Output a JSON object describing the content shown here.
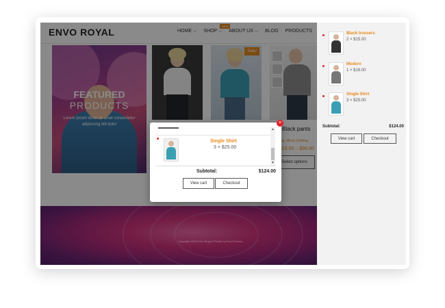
{
  "site": {
    "logo": "ENVO ROYAL",
    "nav": {
      "home": "HOME",
      "shop": "SHOP",
      "shop_badge": "NEW",
      "about": "ABOUT US",
      "blog": "BLOG",
      "products": "PRODUCTS"
    }
  },
  "hero": {
    "title": "FEATURED",
    "subtitle": "PRODUCTS",
    "text": "Lorem ipsum dolor sit amet consectetur adipiscing elit dolor"
  },
  "products": {
    "sale_badge": "Sale!",
    "third": {
      "title": "Black pants",
      "categories": "Clothing, Mens Clothing",
      "price": "$19.00 – $99.00",
      "button": "Select options"
    }
  },
  "side_cart": {
    "items": [
      {
        "name": "Black trousers",
        "qty": "2 × $15.00",
        "color": "#333333"
      },
      {
        "name": "Modern",
        "qty": "1 × $19.00",
        "color": "#777777"
      },
      {
        "name": "Single Shirt",
        "qty": "3 × $25.00",
        "color": "#3b9fb4"
      }
    ],
    "subtotal_label": "Subtotal:",
    "subtotal_value": "$124.00",
    "view_cart": "View cart",
    "checkout": "Checkout"
  },
  "popup": {
    "item": {
      "name": "Single Shirt",
      "qty": "3 × $25.00"
    },
    "subtotal_label": "Subtotal:",
    "subtotal_value": "$124.00",
    "view_cart": "View cart",
    "checkout": "Checkout",
    "close_icon": "×"
  },
  "colors": {
    "accent": "#e8881a",
    "close": "#e0242b"
  },
  "footer": "Copyright 2023 Envo Royal | Theme by EnvoThemes"
}
